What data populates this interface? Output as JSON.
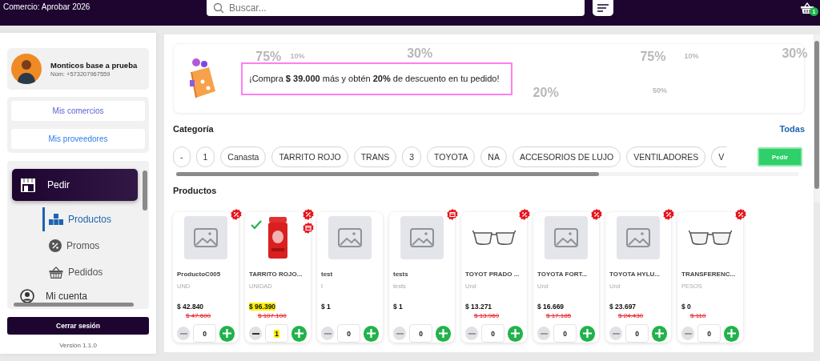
{
  "header": {
    "title": "Comercio: Aprobar 2026",
    "search": {
      "placeholder": "Buscar..."
    },
    "cart_count": "1"
  },
  "sidebar": {
    "profile": {
      "name": "Monticos base a prueba",
      "phone": "Núm: +573207967559"
    },
    "links": [
      "Mis comercios",
      "Mis proveedores"
    ],
    "nav": [
      {
        "label": "Pedir",
        "selected": true,
        "children": [
          {
            "label": "Productos",
            "selected": true
          },
          {
            "label": "Promos",
            "selected": false
          },
          {
            "label": "Pedidos",
            "selected": false
          }
        ]
      },
      {
        "label": "Mi cuenta",
        "selected": false
      }
    ],
    "logout": "Cerrar sesión",
    "version": "Versión 1.1.0"
  },
  "banner": {
    "message": "¡Compra **$ 39.000** más y obtén **20%** de descuento en tu pedido!",
    "decor": [
      "75%",
      "10%",
      "30%",
      "75%",
      "10%",
      "30%",
      "20%",
      "50%"
    ]
  },
  "categories": {
    "title": "Categoría",
    "all_link": "Todas",
    "chips": [
      "-",
      "1",
      "Canasta",
      "TARRITO ROJO",
      "TRANS",
      "3",
      "TOYOTA",
      "NA",
      "ACCESORIOS DE LUJO",
      "VENTILADORES",
      "V"
    ],
    "action": "Pedir"
  },
  "products": {
    "title": "Productos",
    "items": [
      {
        "name": "ProductoC005",
        "unit": "UND",
        "price": "$ 42.840",
        "old_price": "$ 47.600",
        "qty": "0",
        "kind": "placeholder",
        "in_cart": false,
        "discount": true,
        "scheduled": false
      },
      {
        "name": "TARRITO ROJO...",
        "unit": "UNIDAD",
        "price": "$ 96.390",
        "old_price": "$ 107.100",
        "qty": "1",
        "kind": "picture",
        "in_cart": true,
        "discount": true,
        "scheduled": true
      },
      {
        "name": "test",
        "unit": "t",
        "price": "$ 1",
        "qty": "0",
        "kind": "placeholder",
        "in_cart": false,
        "discount": false,
        "scheduled": false
      },
      {
        "name": "tests",
        "unit": "tests",
        "price": "$ 1",
        "qty": "0",
        "kind": "placeholder",
        "in_cart": false,
        "discount": false,
        "scheduled": true
      },
      {
        "name": "TOYOT PRADO ...",
        "unit": "Und",
        "price": "$ 13.271",
        "old_price": "$ 13.969",
        "qty": "0",
        "kind": "picture",
        "in_cart": false,
        "discount": true,
        "scheduled": false
      },
      {
        "name": "TOYOTA FORT...",
        "unit": "Und",
        "price": "$ 16.669",
        "old_price": "$ 17.185",
        "qty": "0",
        "kind": "placeholder",
        "in_cart": false,
        "discount": true,
        "scheduled": false
      },
      {
        "name": "TOYOTA HYLU...",
        "unit": "Und",
        "price": "$ 23.697",
        "old_price": "$ 24.430",
        "qty": "0",
        "kind": "placeholder",
        "in_cart": false,
        "discount": true,
        "scheduled": false
      },
      {
        "name": "TRANSFERENC...",
        "unit": "PESOS",
        "price": "$ 0",
        "old_price": "$ 110",
        "qty": "0",
        "kind": "picture",
        "in_cart": false,
        "discount": true,
        "scheduled": false
      }
    ]
  }
}
